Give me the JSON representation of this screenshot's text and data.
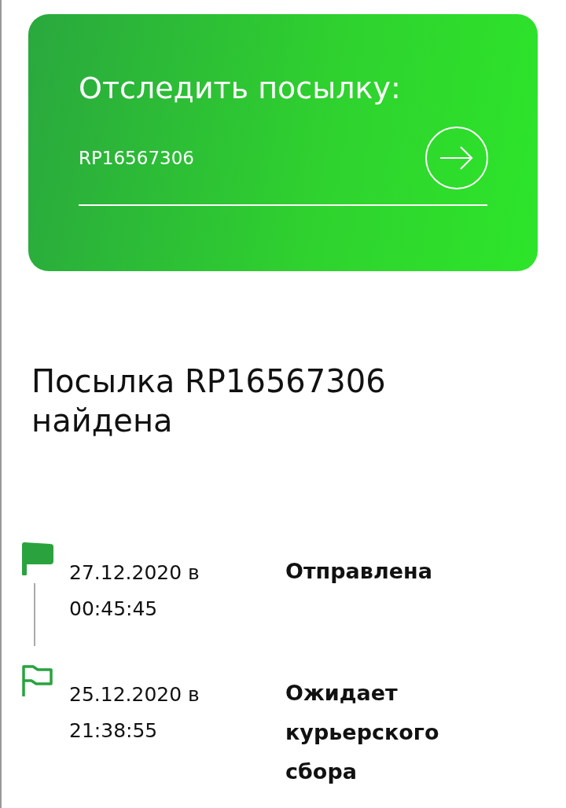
{
  "tracker": {
    "title": "Отследить посылку:",
    "value": "RP16567306"
  },
  "result": {
    "heading": "Посылка RP16567306 найдена"
  },
  "events": [
    {
      "date": "27.12.2020 в",
      "time": "00:45:45",
      "status": "Отправлена",
      "current": true
    },
    {
      "date": "25.12.2020 в",
      "time": "21:38:55",
      "status": "Ожидает курьерского сбора",
      "current": false
    }
  ]
}
